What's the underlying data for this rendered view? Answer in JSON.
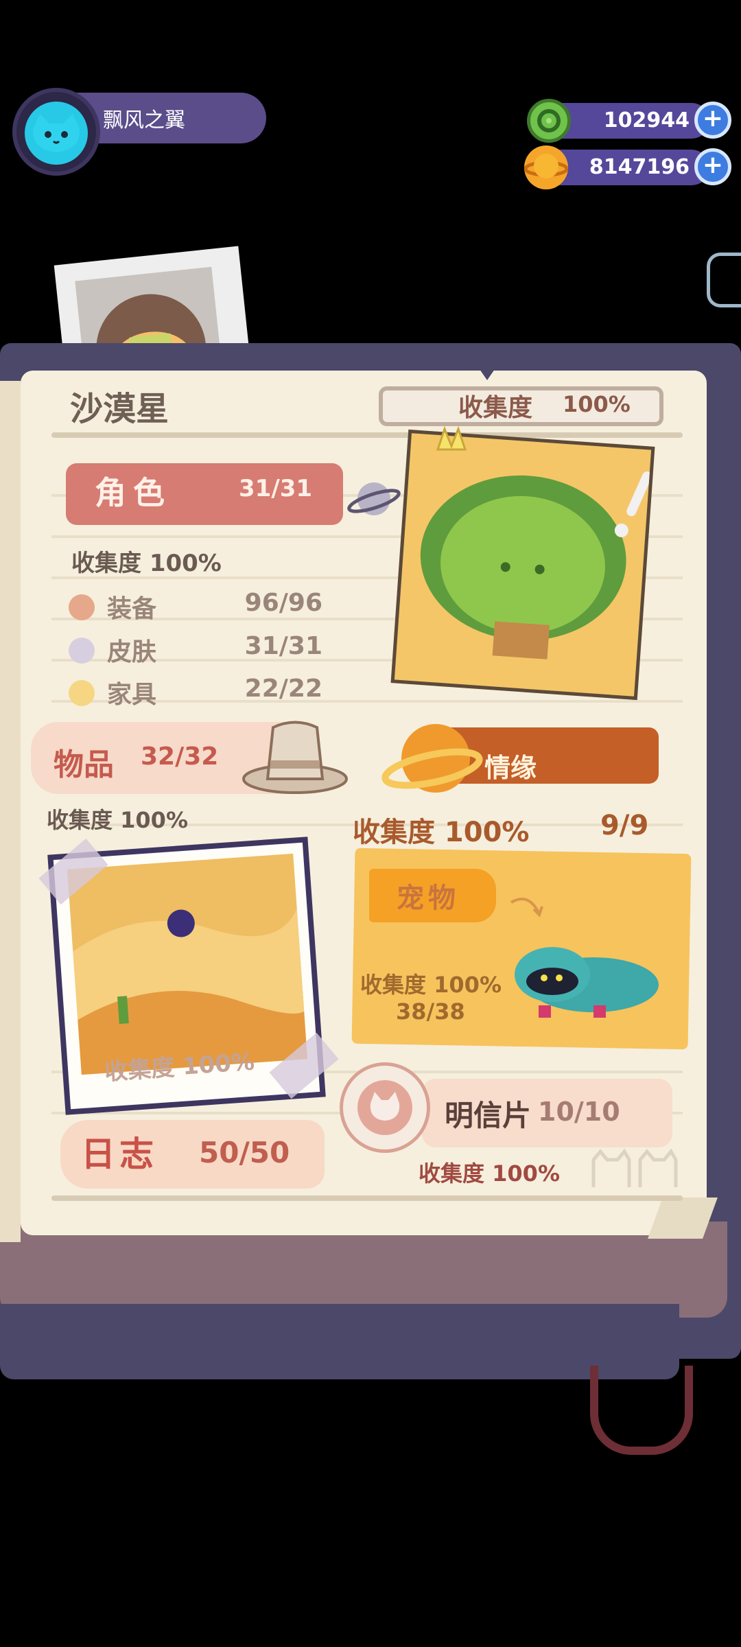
{
  "player": {
    "name": "飘风之翼"
  },
  "currencies": [
    {
      "name": "gem",
      "value": "102944",
      "icon": "green-ring-coin-icon"
    },
    {
      "name": "gold",
      "value": "8147196",
      "icon": "orange-planet-coin-icon"
    }
  ],
  "planet": {
    "title": "沙漠星",
    "overall_collect": "收集度",
    "overall_value": "100%"
  },
  "role": {
    "label": "角色",
    "count": "31/31",
    "collect": "收集度 100%",
    "sub": [
      {
        "label": "装备",
        "count": "96/96",
        "color": "#e6a88a"
      },
      {
        "label": "皮肤",
        "count": "31/31",
        "color": "#d7cfe0"
      },
      {
        "label": "家具",
        "count": "22/22",
        "color": "#f6d683"
      }
    ]
  },
  "items": {
    "label": "物品",
    "count": "32/32",
    "collect": "收集度 100%"
  },
  "affinity": {
    "label": "情缘",
    "collect": "收集度 100%",
    "count": "9/9"
  },
  "photo": {
    "collect": "收集度 100%"
  },
  "pet": {
    "label": "宠物",
    "collect": "收集度 100%",
    "count": "38/38"
  },
  "postcard": {
    "label": "明信片",
    "count": "10/10",
    "collect": "收集度 100%"
  },
  "journal": {
    "label": "日志",
    "count": "50/50"
  }
}
